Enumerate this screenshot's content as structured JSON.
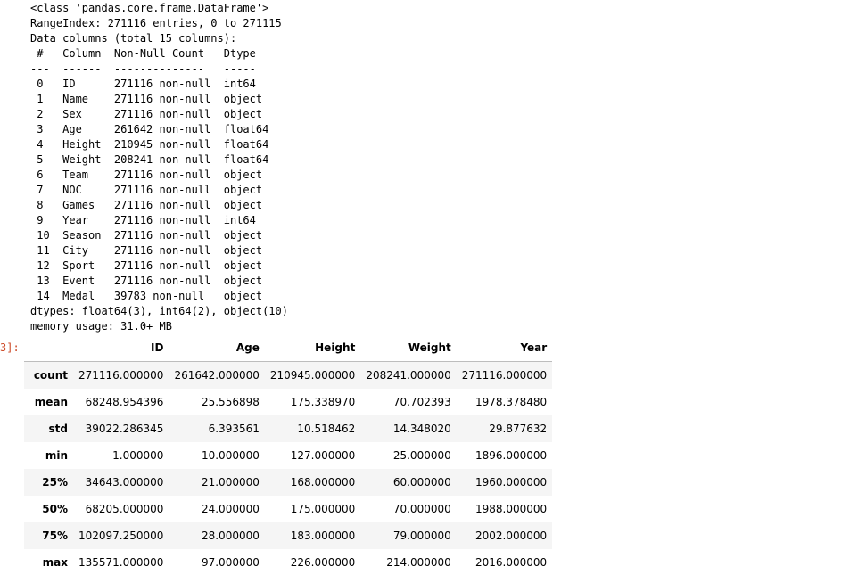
{
  "info_output": {
    "lines": [
      "<class 'pandas.core.frame.DataFrame'>",
      "RangeIndex: 271116 entries, 0 to 271115",
      "Data columns (total 15 columns):",
      " #   Column  Non-Null Count   Dtype  ",
      "---  ------  --------------   -----  ",
      " 0   ID      271116 non-null  int64  ",
      " 1   Name    271116 non-null  object ",
      " 2   Sex     271116 non-null  object ",
      " 3   Age     261642 non-null  float64",
      " 4   Height  210945 non-null  float64",
      " 5   Weight  208241 non-null  float64",
      " 6   Team    271116 non-null  object ",
      " 7   NOC     271116 non-null  object ",
      " 8   Games   271116 non-null  object ",
      " 9   Year    271116 non-null  int64  ",
      " 10  Season  271116 non-null  object ",
      " 11  City    271116 non-null  object ",
      " 12  Sport   271116 non-null  object ",
      " 13  Event   271116 non-null  object ",
      " 14  Medal   39783 non-null   object ",
      "dtypes: float64(3), int64(2), object(10)",
      "memory usage: 31.0+ MB"
    ]
  },
  "cell_prompt": "3]:",
  "describe_table": {
    "columns": [
      "ID",
      "Age",
      "Height",
      "Weight",
      "Year"
    ],
    "rows": [
      {
        "label": "count",
        "values": [
          "271116.000000",
          "261642.000000",
          "210945.000000",
          "208241.000000",
          "271116.000000"
        ]
      },
      {
        "label": "mean",
        "values": [
          "68248.954396",
          "25.556898",
          "175.338970",
          "70.702393",
          "1978.378480"
        ]
      },
      {
        "label": "std",
        "values": [
          "39022.286345",
          "6.393561",
          "10.518462",
          "14.348020",
          "29.877632"
        ]
      },
      {
        "label": "min",
        "values": [
          "1.000000",
          "10.000000",
          "127.000000",
          "25.000000",
          "1896.000000"
        ]
      },
      {
        "label": "25%",
        "values": [
          "34643.000000",
          "21.000000",
          "168.000000",
          "60.000000",
          "1960.000000"
        ]
      },
      {
        "label": "50%",
        "values": [
          "68205.000000",
          "24.000000",
          "175.000000",
          "70.000000",
          "1988.000000"
        ]
      },
      {
        "label": "75%",
        "values": [
          "102097.250000",
          "28.000000",
          "183.000000",
          "79.000000",
          "2002.000000"
        ]
      },
      {
        "label": "max",
        "values": [
          "135571.000000",
          "97.000000",
          "226.000000",
          "214.000000",
          "2016.000000"
        ]
      }
    ]
  }
}
